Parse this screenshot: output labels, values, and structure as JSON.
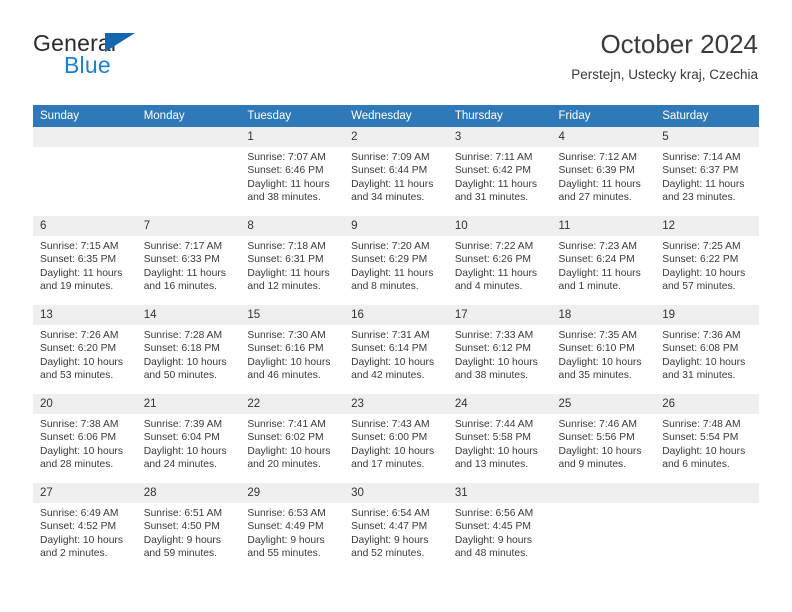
{
  "brand": {
    "name_top": "General",
    "name_bottom": "Blue",
    "triangle_color": "#1566b0",
    "blue_text_color": "#1b7fd4"
  },
  "header": {
    "title": "October 2024",
    "subtitle": "Perstejn, Ustecky kraj, Czechia"
  },
  "theme": {
    "header_blue": "#3079b8",
    "row_divider_blue": "#2f6fa8",
    "daynum_band": "#efefef"
  },
  "calendar": {
    "weekday_headers": [
      "Sunday",
      "Monday",
      "Tuesday",
      "Wednesday",
      "Thursday",
      "Friday",
      "Saturday"
    ],
    "labels": {
      "sunrise_prefix": "Sunrise:",
      "sunset_prefix": "Sunset:",
      "daylight_prefix": "Daylight:"
    },
    "weeks": [
      [
        {
          "day": "",
          "sunrise": "",
          "sunset": "",
          "daylight": ""
        },
        {
          "day": "",
          "sunrise": "",
          "sunset": "",
          "daylight": ""
        },
        {
          "day": "1",
          "sunrise": "Sunrise: 7:07 AM",
          "sunset": "Sunset: 6:46 PM",
          "daylight": "Daylight: 11 hours and 38 minutes."
        },
        {
          "day": "2",
          "sunrise": "Sunrise: 7:09 AM",
          "sunset": "Sunset: 6:44 PM",
          "daylight": "Daylight: 11 hours and 34 minutes."
        },
        {
          "day": "3",
          "sunrise": "Sunrise: 7:11 AM",
          "sunset": "Sunset: 6:42 PM",
          "daylight": "Daylight: 11 hours and 31 minutes."
        },
        {
          "day": "4",
          "sunrise": "Sunrise: 7:12 AM",
          "sunset": "Sunset: 6:39 PM",
          "daylight": "Daylight: 11 hours and 27 minutes."
        },
        {
          "day": "5",
          "sunrise": "Sunrise: 7:14 AM",
          "sunset": "Sunset: 6:37 PM",
          "daylight": "Daylight: 11 hours and 23 minutes."
        }
      ],
      [
        {
          "day": "6",
          "sunrise": "Sunrise: 7:15 AM",
          "sunset": "Sunset: 6:35 PM",
          "daylight": "Daylight: 11 hours and 19 minutes."
        },
        {
          "day": "7",
          "sunrise": "Sunrise: 7:17 AM",
          "sunset": "Sunset: 6:33 PM",
          "daylight": "Daylight: 11 hours and 16 minutes."
        },
        {
          "day": "8",
          "sunrise": "Sunrise: 7:18 AM",
          "sunset": "Sunset: 6:31 PM",
          "daylight": "Daylight: 11 hours and 12 minutes."
        },
        {
          "day": "9",
          "sunrise": "Sunrise: 7:20 AM",
          "sunset": "Sunset: 6:29 PM",
          "daylight": "Daylight: 11 hours and 8 minutes."
        },
        {
          "day": "10",
          "sunrise": "Sunrise: 7:22 AM",
          "sunset": "Sunset: 6:26 PM",
          "daylight": "Daylight: 11 hours and 4 minutes."
        },
        {
          "day": "11",
          "sunrise": "Sunrise: 7:23 AM",
          "sunset": "Sunset: 6:24 PM",
          "daylight": "Daylight: 11 hours and 1 minute."
        },
        {
          "day": "12",
          "sunrise": "Sunrise: 7:25 AM",
          "sunset": "Sunset: 6:22 PM",
          "daylight": "Daylight: 10 hours and 57 minutes."
        }
      ],
      [
        {
          "day": "13",
          "sunrise": "Sunrise: 7:26 AM",
          "sunset": "Sunset: 6:20 PM",
          "daylight": "Daylight: 10 hours and 53 minutes."
        },
        {
          "day": "14",
          "sunrise": "Sunrise: 7:28 AM",
          "sunset": "Sunset: 6:18 PM",
          "daylight": "Daylight: 10 hours and 50 minutes."
        },
        {
          "day": "15",
          "sunrise": "Sunrise: 7:30 AM",
          "sunset": "Sunset: 6:16 PM",
          "daylight": "Daylight: 10 hours and 46 minutes."
        },
        {
          "day": "16",
          "sunrise": "Sunrise: 7:31 AM",
          "sunset": "Sunset: 6:14 PM",
          "daylight": "Daylight: 10 hours and 42 minutes."
        },
        {
          "day": "17",
          "sunrise": "Sunrise: 7:33 AM",
          "sunset": "Sunset: 6:12 PM",
          "daylight": "Daylight: 10 hours and 38 minutes."
        },
        {
          "day": "18",
          "sunrise": "Sunrise: 7:35 AM",
          "sunset": "Sunset: 6:10 PM",
          "daylight": "Daylight: 10 hours and 35 minutes."
        },
        {
          "day": "19",
          "sunrise": "Sunrise: 7:36 AM",
          "sunset": "Sunset: 6:08 PM",
          "daylight": "Daylight: 10 hours and 31 minutes."
        }
      ],
      [
        {
          "day": "20",
          "sunrise": "Sunrise: 7:38 AM",
          "sunset": "Sunset: 6:06 PM",
          "daylight": "Daylight: 10 hours and 28 minutes."
        },
        {
          "day": "21",
          "sunrise": "Sunrise: 7:39 AM",
          "sunset": "Sunset: 6:04 PM",
          "daylight": "Daylight: 10 hours and 24 minutes."
        },
        {
          "day": "22",
          "sunrise": "Sunrise: 7:41 AM",
          "sunset": "Sunset: 6:02 PM",
          "daylight": "Daylight: 10 hours and 20 minutes."
        },
        {
          "day": "23",
          "sunrise": "Sunrise: 7:43 AM",
          "sunset": "Sunset: 6:00 PM",
          "daylight": "Daylight: 10 hours and 17 minutes."
        },
        {
          "day": "24",
          "sunrise": "Sunrise: 7:44 AM",
          "sunset": "Sunset: 5:58 PM",
          "daylight": "Daylight: 10 hours and 13 minutes."
        },
        {
          "day": "25",
          "sunrise": "Sunrise: 7:46 AM",
          "sunset": "Sunset: 5:56 PM",
          "daylight": "Daylight: 10 hours and 9 minutes."
        },
        {
          "day": "26",
          "sunrise": "Sunrise: 7:48 AM",
          "sunset": "Sunset: 5:54 PM",
          "daylight": "Daylight: 10 hours and 6 minutes."
        }
      ],
      [
        {
          "day": "27",
          "sunrise": "Sunrise: 6:49 AM",
          "sunset": "Sunset: 4:52 PM",
          "daylight": "Daylight: 10 hours and 2 minutes."
        },
        {
          "day": "28",
          "sunrise": "Sunrise: 6:51 AM",
          "sunset": "Sunset: 4:50 PM",
          "daylight": "Daylight: 9 hours and 59 minutes."
        },
        {
          "day": "29",
          "sunrise": "Sunrise: 6:53 AM",
          "sunset": "Sunset: 4:49 PM",
          "daylight": "Daylight: 9 hours and 55 minutes."
        },
        {
          "day": "30",
          "sunrise": "Sunrise: 6:54 AM",
          "sunset": "Sunset: 4:47 PM",
          "daylight": "Daylight: 9 hours and 52 minutes."
        },
        {
          "day": "31",
          "sunrise": "Sunrise: 6:56 AM",
          "sunset": "Sunset: 4:45 PM",
          "daylight": "Daylight: 9 hours and 48 minutes."
        },
        {
          "day": "",
          "sunrise": "",
          "sunset": "",
          "daylight": ""
        },
        {
          "day": "",
          "sunrise": "",
          "sunset": "",
          "daylight": ""
        }
      ]
    ]
  }
}
